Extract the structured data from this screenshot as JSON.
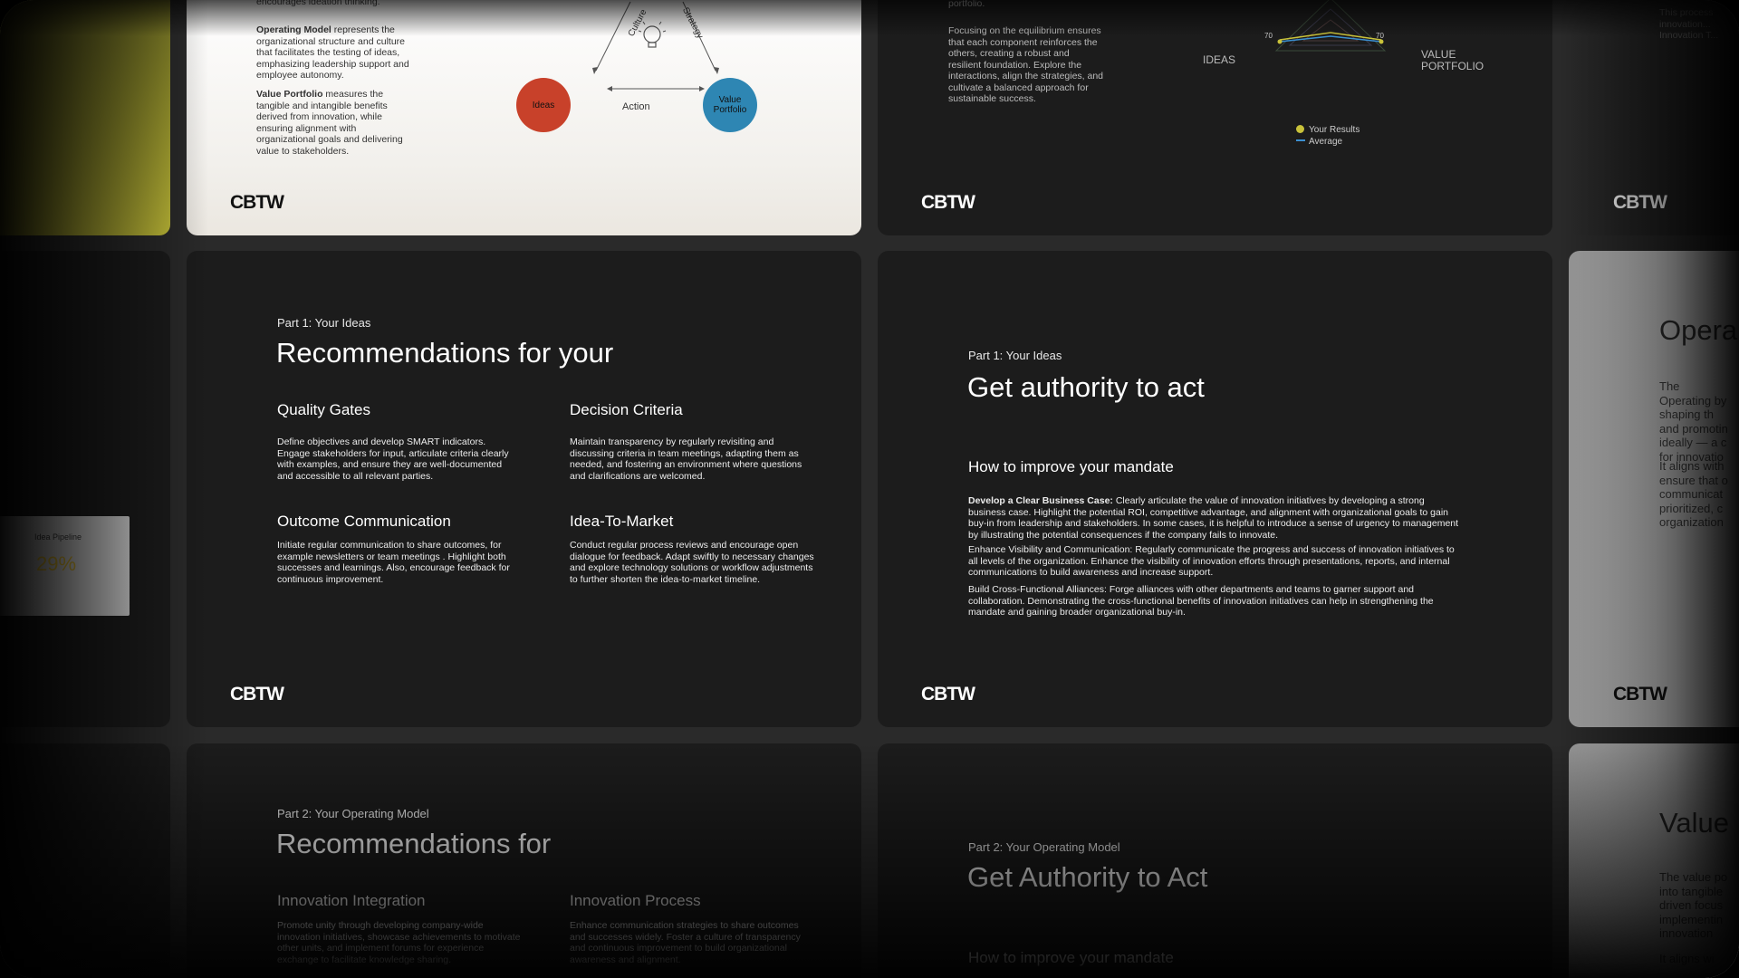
{
  "brand": {
    "logo": "CBTW"
  },
  "slides": {
    "top_left_model": {
      "partial_top_text": "encourages ideation thinking.",
      "operating_model_bold": "Operating Model",
      "operating_model_text": " represents the organizational structure and culture that facilitates the testing of ideas, emphasizing leadership support and employee autonomy.",
      "value_portfolio_bold": "Value Portfolio",
      "value_portfolio_text": " measures the tangible and intangible benefits derived from innovation, while ensuring alignment with organizational goals and delivering value to stakeholders.",
      "diagram": {
        "culture": "Culture",
        "strategy": "Strategy",
        "action": "Action",
        "ideas": "Ideas",
        "value_portfolio": "Value Portfolio",
        "ideas_color": "#c8412a",
        "value_color": "#2e86b3"
      }
    },
    "top_right_radar": {
      "partial_top_text": "portfolio.",
      "body": "Focusing on the equilibrium ensures that each component reinforces the others, creating a robust and resilient foundation. Explore the interactions, align the strategies, and cultivate a balanced approach for sustainable success.",
      "axis_ideas": "IDEAS",
      "axis_value": "VALUE",
      "axis_portfolio": "PORTFOLIO",
      "tick_left": "70",
      "tick_right": "70",
      "legend_results": "Your Results",
      "legend_average": "Average",
      "results_color": "#c9c23a",
      "average_color": "#3b8fd0"
    },
    "far_right_top": {
      "text": "This process innovation... Innovation T..."
    },
    "left_pipeline": {
      "label": "Idea Pipeline",
      "value": "29%"
    },
    "mid_left": {
      "eyebrow": "Part 1: Your Ideas",
      "title": "Recommendations for your",
      "items": [
        {
          "heading": "Quality Gates",
          "text": "Define objectives and develop SMART indicators. Engage stakeholders for input, articulate criteria clearly with examples, and ensure they are well-documented and accessible to all relevant parties."
        },
        {
          "heading": "Decision Criteria",
          "text": "Maintain transparency by regularly revisiting and discussing criteria in team meetings, adapting them as needed, and fostering an environment where questions and clarifications are welcomed."
        },
        {
          "heading": "Outcome Communication",
          "text": "Initiate regular communication to share outcomes, for example newsletters or team meetings . Highlight both successes and learnings. Also, encourage feedback for continuous improvement."
        },
        {
          "heading": "Idea-To-Market",
          "text": "Conduct regular process reviews and encourage open dialogue for feedback. Adapt swiftly to necessary changes and explore technology solutions or workflow adjustments to further shorten the idea-to-market timeline."
        }
      ]
    },
    "mid_right": {
      "eyebrow": "Part 1: Your Ideas",
      "title": "Get authority to act",
      "subhead": "How to improve your mandate",
      "p1_bold": "Develop a Clear Business Case:",
      "p1_text": " Clearly articulate the value of innovation initiatives by developing a strong business case. Highlight the potential ROI, competitive advantage, and alignment with organizational goals to gain buy-in from leadership and stakeholders. In some cases, it is helpful to introduce a sense of urgency to management by illustrating the potential consequences if the company fails to innovate.",
      "p2": "Enhance Visibility and Communication: Regularly communicate the progress and success of innovation initiatives to all levels of the organization. Enhance the visibility of innovation efforts through presentations, reports, and internal communications to build awareness and increase support.",
      "p3": "Build Cross-Functional Alliances: Forge alliances with other departments and teams to garner support and collaboration. Demonstrating the cross-functional benefits of innovation initiatives can help in strengthening the mandate and gaining broader organizational buy-in."
    },
    "mid_far_right": {
      "title": "Opera",
      "p1": "The Operating by shaping th and promotin ideally — a c for innovatio",
      "p2": "It aligns with ensure that o communicat prioritized, c organization"
    },
    "bottom_left": {
      "eyebrow": "Part 2: Your Operating Model",
      "title": "Recommendations for",
      "items": [
        {
          "heading": "Innovation Integration",
          "text": "Promote unity through developing company-wide innovation initiatives, showcase achievements to motivate other units, and implement forums for experience exchange to facilitate knowledge sharing."
        },
        {
          "heading": "Innovation Process",
          "text": "Enhance communication strategies to share outcomes and successes widely. Foster a culture of transparency and continuous improvement to build organizational awareness and alignment."
        }
      ]
    },
    "bottom_right": {
      "eyebrow": "Part 2: Your Operating Model",
      "title": "Get Authority to Act",
      "subhead": "How to improve your mandate"
    },
    "bottom_far_right": {
      "title": "Value",
      "p1": "The value po into tangible driven focus implementin innovation",
      "p2": "It aligns wi"
    }
  }
}
